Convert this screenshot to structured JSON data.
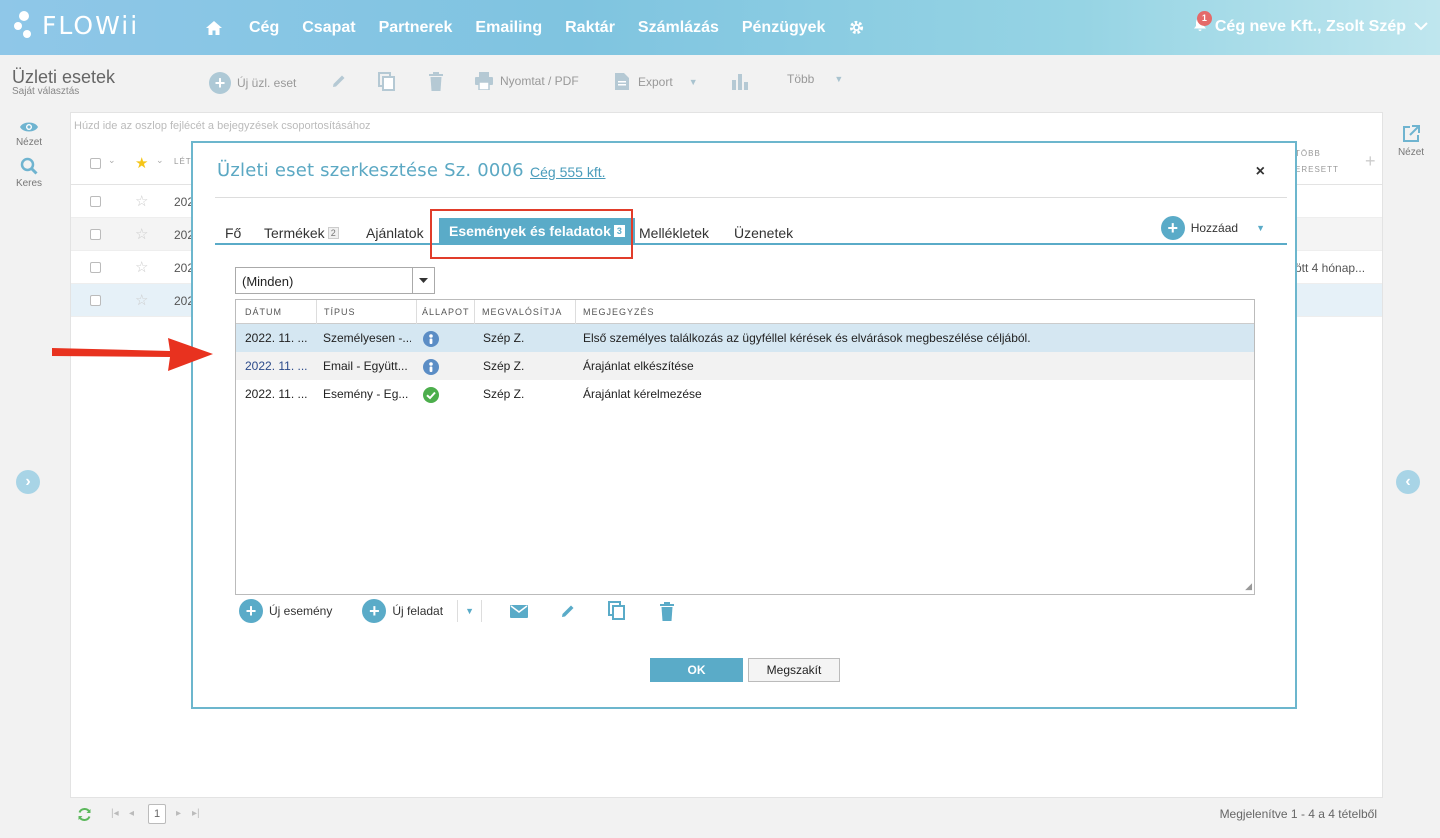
{
  "app": {
    "logo_text": "FLOWii"
  },
  "nav": {
    "items": [
      "Cég",
      "Csapat",
      "Partnerek",
      "Emailing",
      "Raktár",
      "Számlázás",
      "Pénzügyek"
    ],
    "notification_count": "1",
    "company_user": "Cég neve Kft., Zsolt Szép"
  },
  "page": {
    "title": "Üzleti esetek",
    "subtitle": "Saját választás"
  },
  "toolbar": {
    "new_label": "Új üzl. eset",
    "print_label": "Nyomtat / PDF",
    "export_label": "Export",
    "more_label": "Több"
  },
  "left_panel": {
    "view_label": "Nézet",
    "search_label": "Keres"
  },
  "right_panel": {
    "view_label": "Nézet"
  },
  "grid": {
    "group_hint": "Húzd ide az oszlop fejlécét a bejegyzések csoportosításához",
    "header_left": "LÉT",
    "header_right_1": "TÖBB",
    "header_right_2": "ERESETT",
    "rows": [
      "202",
      "202",
      "202",
      "202"
    ],
    "row3_right": "ött 4 hónap..."
  },
  "footer": {
    "page": "1",
    "summary": "Megjelenítve 1 - 4 a 4 tételből"
  },
  "modal": {
    "title": "Üzleti eset szerkesztése Sz. 0006",
    "company_link": "Cég 555 kft.",
    "close": "×",
    "tabs": {
      "fo": "Fő",
      "termekek": "Termékek",
      "termekek_count": "2",
      "ajanlatok": "Ajánlatok",
      "esemenyek": "Események és feladatok",
      "esemenyek_count": "3",
      "mellekletek": "Mellékletek",
      "uzenetek": "Üzenetek"
    },
    "add_label": "Hozzáad",
    "filter_value": "(Minden)",
    "columns": [
      "DÁTUM",
      "TÍPUS",
      "ÁLLAPOT",
      "MEGVALÓSÍTJA",
      "MEGJEGYZÉS"
    ],
    "events": [
      {
        "date": "2022. 11. ...",
        "type": "Személyesen -...",
        "status": "info",
        "owner": "Szép Z.",
        "note": "Első személyes találkozás az ügyféllel kérések és elvárások megbeszélése céljából."
      },
      {
        "date": "2022. 11. ...",
        "type": "Email - Együtt...",
        "status": "info",
        "owner": "Szép Z.",
        "note": "Árajánlat elkészítése"
      },
      {
        "date": "2022. 11. ...",
        "type": "Esemény - Eg...",
        "status": "done",
        "owner": "Szép Z.",
        "note": "Árajánlat kérelmezése"
      }
    ],
    "new_event_label": "Új esemény",
    "new_task_label": "Új feladat",
    "ok_label": "OK",
    "cancel_label": "Megszakít"
  },
  "colors": {
    "accent": "#5aabc8",
    "highlight": "#e13c2a",
    "status_info": "#5b8dc5",
    "status_done": "#4cae4c"
  }
}
